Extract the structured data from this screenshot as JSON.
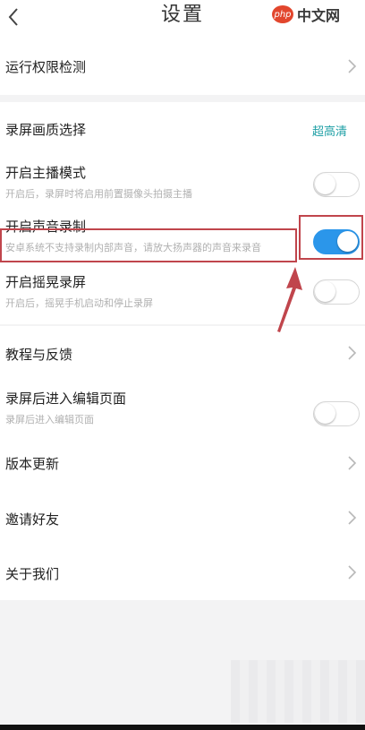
{
  "header": {
    "title": "设置",
    "back_icon": "chevron-left-icon"
  },
  "watermark": {
    "logo_text": "php",
    "site_text": "中文网"
  },
  "settings": {
    "permission_check": {
      "title": "运行权限检测"
    },
    "quality": {
      "title": "录屏画质选择",
      "value": "超高清"
    },
    "anchor_mode": {
      "title": "开启主播模式",
      "subtitle": "开启后，录屏时将启用前置摄像头拍摄主播",
      "enabled": false
    },
    "audio_record": {
      "title": "开启声音录制",
      "subtitle": "安卓系统不支持录制内部声音，请放大扬声器的声音来录音",
      "enabled": true
    },
    "shake_record": {
      "title": "开启摇晃录屏",
      "subtitle": "开启后，摇晃手机启动和停止录屏",
      "enabled": false
    },
    "tutorial": {
      "title": "教程与反馈"
    },
    "edit_after": {
      "title": "录屏后进入编辑页面",
      "subtitle": "录屏后进入编辑页面",
      "enabled": false
    },
    "update": {
      "title": "版本更新"
    },
    "invite": {
      "title": "邀请好友"
    },
    "about": {
      "title": "关于我们"
    }
  },
  "colors": {
    "accent_value": "#1e9fa5",
    "toggle_on": "#2b96ea",
    "highlight": "#c0454c",
    "background": "#f3f3f4"
  }
}
